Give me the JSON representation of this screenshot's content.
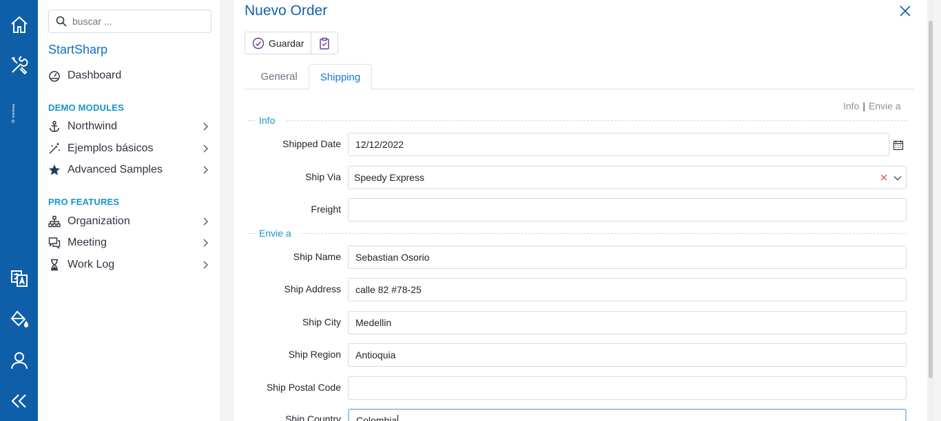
{
  "rail": {
    "brand_text": "StartSharp",
    "icons": [
      "home-icon",
      "tools-icon",
      "translate-icon",
      "paint-bucket-icon",
      "user-icon",
      "collapse-icon"
    ]
  },
  "sidebar": {
    "search_placeholder": "buscar ...",
    "brand": "StartSharp",
    "dashboard": "Dashboard",
    "demo_heading": "DEMO MODULES",
    "demo_items": [
      "Northwind",
      "Ejemplos básicos",
      "Advanced Samples"
    ],
    "pro_heading": "PRO FEATURES",
    "pro_items": [
      "Organization",
      "Meeting",
      "Work Log"
    ]
  },
  "dialog": {
    "title": "Nuevo Order",
    "toolbar": {
      "save_label": "Guardar"
    },
    "tabs": [
      "General",
      "Shipping"
    ],
    "active_tab": "Shipping",
    "category_links": [
      "Info",
      "Envie a"
    ],
    "categories": {
      "info": "Info",
      "ship_to": "Envie a"
    },
    "fields": {
      "shipped_date": {
        "label": "Shipped Date",
        "value": "12/12/2022"
      },
      "ship_via": {
        "label": "Ship Via",
        "value": "Speedy Express"
      },
      "freight": {
        "label": "Freight",
        "value": ""
      },
      "ship_name": {
        "label": "Ship Name",
        "value": "Sebastian Osorio"
      },
      "ship_address": {
        "label": "Ship Address",
        "value": "calle 82 #78-25"
      },
      "ship_city": {
        "label": "Ship City",
        "value": "Medellin"
      },
      "ship_region": {
        "label": "Ship Region",
        "value": "Antioquia"
      },
      "ship_postal_code": {
        "label": "Ship Postal Code",
        "value": ""
      },
      "ship_country": {
        "label": "Ship Country",
        "value": "Colombia"
      }
    }
  },
  "colors": {
    "rail": "#0f5fa8",
    "accent": "#1170c7",
    "section_heading": "#1396c9"
  }
}
